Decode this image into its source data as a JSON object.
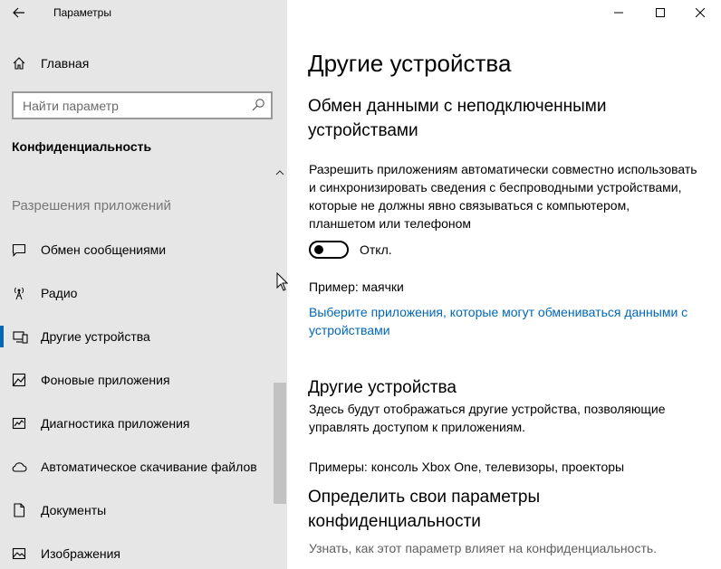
{
  "window": {
    "title": "Параметры"
  },
  "sidebar": {
    "home_label": "Главная",
    "search": {
      "placeholder": "Найти параметр"
    },
    "section_heading": "Конфиденциальность",
    "group_heading": "Разрешения приложений",
    "items": [
      {
        "label": "Обмен сообщениями",
        "icon": "message-icon",
        "selected": false
      },
      {
        "label": "Радио",
        "icon": "radio-antenna-icon",
        "selected": false
      },
      {
        "label": "Другие устройства",
        "icon": "devices-icon",
        "selected": true
      },
      {
        "label": "Фоновые приложения",
        "icon": "background-apps-icon",
        "selected": false
      },
      {
        "label": "Диагностика приложения",
        "icon": "diagnostics-icon",
        "selected": false
      },
      {
        "label": "Автоматическое скачивание файлов",
        "icon": "cloud-icon",
        "selected": false
      },
      {
        "label": "Документы",
        "icon": "document-icon",
        "selected": false
      },
      {
        "label": "Изображения",
        "icon": "image-icon",
        "selected": false
      }
    ]
  },
  "main": {
    "page_title": "Другие устройства",
    "sync": {
      "heading": "Обмен данными с неподключенными устройствами",
      "description": "Разрешить приложениям автоматически совместно использовать и синхронизировать сведения с беспроводными устройствами, которые не должны явно связываться с компьютером, планшетом или телефоном",
      "toggle_state_label": "Откл.",
      "toggle_on": false,
      "example": "Пример: маячки",
      "link": "Выберите приложения, которые могут обмениваться данными с устройствами"
    },
    "other_devices": {
      "heading": "Другие устройства",
      "description": "Здесь будут отображаться другие устройства, позволяющие управлять доступом к приложениям.",
      "examples": "Примеры: консоль Xbox One, телевизоры, проекторы"
    },
    "privacy": {
      "heading": "Определить свои параметры конфиденциальности",
      "description": "Узнать, как этот параметр влияет на конфиденциальность."
    }
  },
  "colors": {
    "sidebar_bg": "#e6e6e6",
    "accent": "#0067b8",
    "muted_text": "#767676"
  }
}
